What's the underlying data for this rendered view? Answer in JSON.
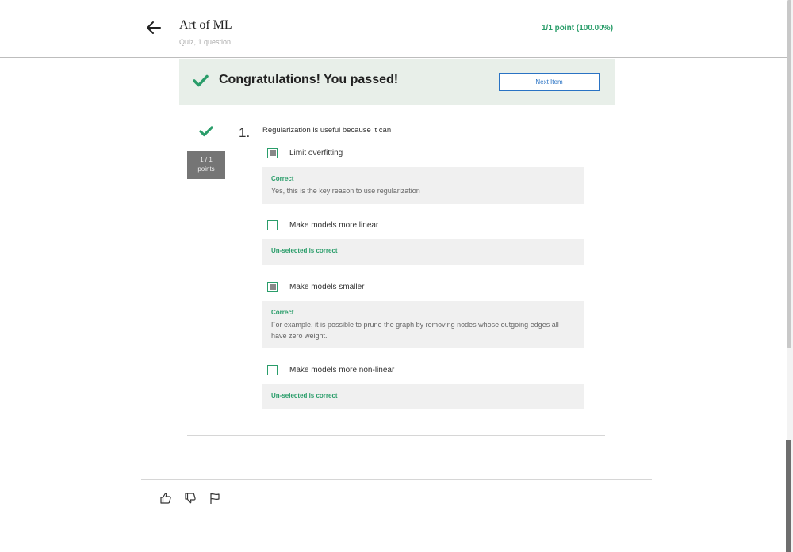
{
  "header": {
    "title": "Art of ML",
    "subtitle": "Quiz, 1 question",
    "score": "1/1 point (100.00%)"
  },
  "banner": {
    "message": "Congratulations! You passed!",
    "next_button": "Next Item"
  },
  "question": {
    "number": "1.",
    "text": "Regularization is useful because it can",
    "points_line1": "1 / 1",
    "points_line2": "points",
    "options": [
      {
        "label": "Limit overfitting",
        "checked": true,
        "feedback_title": "Correct",
        "feedback_text": "Yes, this is the key reason to use regularization"
      },
      {
        "label": "Make models more linear",
        "checked": false,
        "feedback_title": "Un-selected is correct",
        "feedback_text": ""
      },
      {
        "label": "Make models smaller",
        "checked": true,
        "feedback_title": "Correct",
        "feedback_text": "For example, it is possible to prune the graph by removing nodes whose outgoing edges all have zero weight."
      },
      {
        "label": "Make models more non-linear",
        "checked": false,
        "feedback_title": "Un-selected is correct",
        "feedback_text": ""
      }
    ]
  },
  "footer": {
    "icons": [
      "thumbs-up-icon",
      "thumbs-down-icon",
      "flag-icon"
    ]
  },
  "colors": {
    "success_green": "#2a9d6a",
    "link_blue": "#2a73c4",
    "banner_bg": "#e8efe9",
    "feedback_bg": "#f0f0f0"
  }
}
